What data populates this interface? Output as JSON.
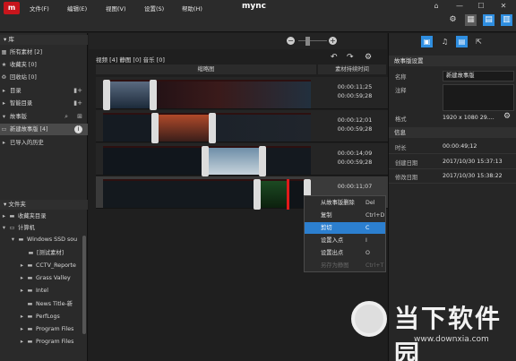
{
  "app": {
    "logo_text": "m",
    "title": "mync",
    "menu": [
      "文件(F)",
      "编辑(E)",
      "视图(V)",
      "设置(S)",
      "帮助(H)"
    ],
    "win_buttons": [
      "⌂",
      "—",
      "☐",
      "✕"
    ]
  },
  "toolbar_icons": [
    "gear-icon",
    "layout-icon",
    "panel-icon",
    "panel-alt-icon"
  ],
  "left": {
    "library_header": "库",
    "library_items": [
      "所有素材 [2]",
      "收藏夹 [0]",
      "回收站 [0]"
    ],
    "folder_items": [
      "目录",
      "智能目录"
    ],
    "storyboard_header": "故事版",
    "storyboard_item": "新建故事版 [4]",
    "history": "已导入的历史",
    "files_header": "文件夹",
    "tree": [
      "收藏夹目录",
      "计算机",
      "Windows SSD sou",
      "[测试素材]",
      "CCTV_Reporte",
      "Grass Valley",
      "Intel",
      "News Title-新",
      "PerfLogs",
      "Program Files",
      "Program Files"
    ]
  },
  "middle": {
    "tabs": "视频 [4]  静图 [0]  音乐 [0]",
    "col_thumb": "缩略图",
    "col_duration": "素材持续时间",
    "rows": [
      {
        "in": "00:00:11;25",
        "out": "00:00:59;28"
      },
      {
        "in": "00:00:12;01",
        "out": "00:00:59;28"
      },
      {
        "in": "00:00:14;09",
        "out": "00:00:59;28"
      },
      {
        "in": "00:00:11;07",
        "out": ""
      }
    ]
  },
  "context_menu": [
    {
      "label": "从故事版删除",
      "key": "Del"
    },
    {
      "label": "复制",
      "key": "Ctrl+D"
    },
    {
      "label": "剪切",
      "key": "C"
    },
    {
      "label": "设置入点",
      "key": "I"
    },
    {
      "label": "设置出点",
      "key": "O"
    },
    {
      "label": "另存为静图",
      "key": "Ctrl+T"
    }
  ],
  "right": {
    "section1": "故事版设置",
    "name_label": "名称",
    "name_value": "新建故事版",
    "note_label": "注释",
    "format_label": "格式",
    "format_value": "1920 x 1080 29....",
    "section2": "信息",
    "duration_label": "时长",
    "duration_value": "00:00:49;12",
    "created_label": "创建日期",
    "created_value": "2017/10/30 15:37:13",
    "modified_label": "修改日期",
    "modified_value": "2017/10/30 15:38:22"
  },
  "watermark": {
    "main": "当下软件园",
    "url": "www.downxia.com"
  }
}
